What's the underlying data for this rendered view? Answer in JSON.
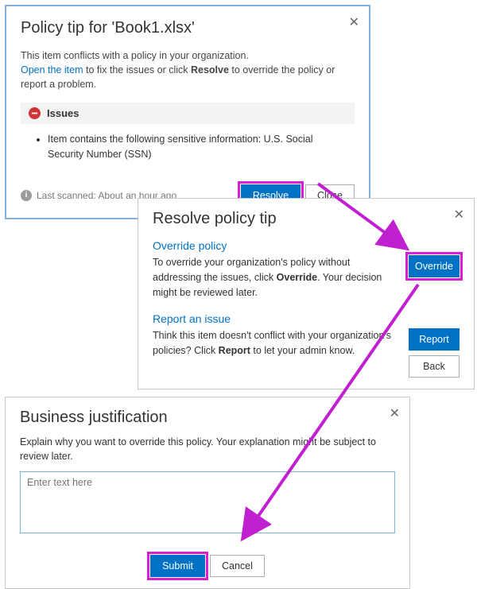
{
  "dialog1": {
    "title": "Policy tip for 'Book1.xlsx'",
    "desc_prefix": "This item conflicts with a policy in your organization.",
    "desc_link": "Open the item",
    "desc_mid": " to fix the issues or click ",
    "desc_bold": "Resolve",
    "desc_suffix": " to override the policy or report a problem.",
    "issues_label": "Issues",
    "issue_item": "Item contains the following sensitive information: U.S. Social Security Number (SSN)",
    "scanned": "Last scanned: About an hour ago",
    "resolve": "Resolve",
    "close": "Close"
  },
  "dialog2": {
    "title": "Resolve policy tip",
    "sec1_hdr": "Override policy",
    "sec1_txt_pre": "To override your organization's policy without addressing the issues, click ",
    "sec1_txt_bold": "Override",
    "sec1_txt_post": ". Your decision might be reviewed later.",
    "override": "Override",
    "sec2_hdr": "Report an issue",
    "sec2_txt_pre": "Think this item doesn't conflict with your organization's policies? Click ",
    "sec2_txt_bold": "Report",
    "sec2_txt_post": " to let your admin know.",
    "report": "Report",
    "back": "Back"
  },
  "dialog3": {
    "title": "Business justification",
    "desc": "Explain why you want to override this policy. Your explanation might be subject to review later.",
    "placeholder": "Enter text here",
    "submit": "Submit",
    "cancel": "Cancel"
  }
}
